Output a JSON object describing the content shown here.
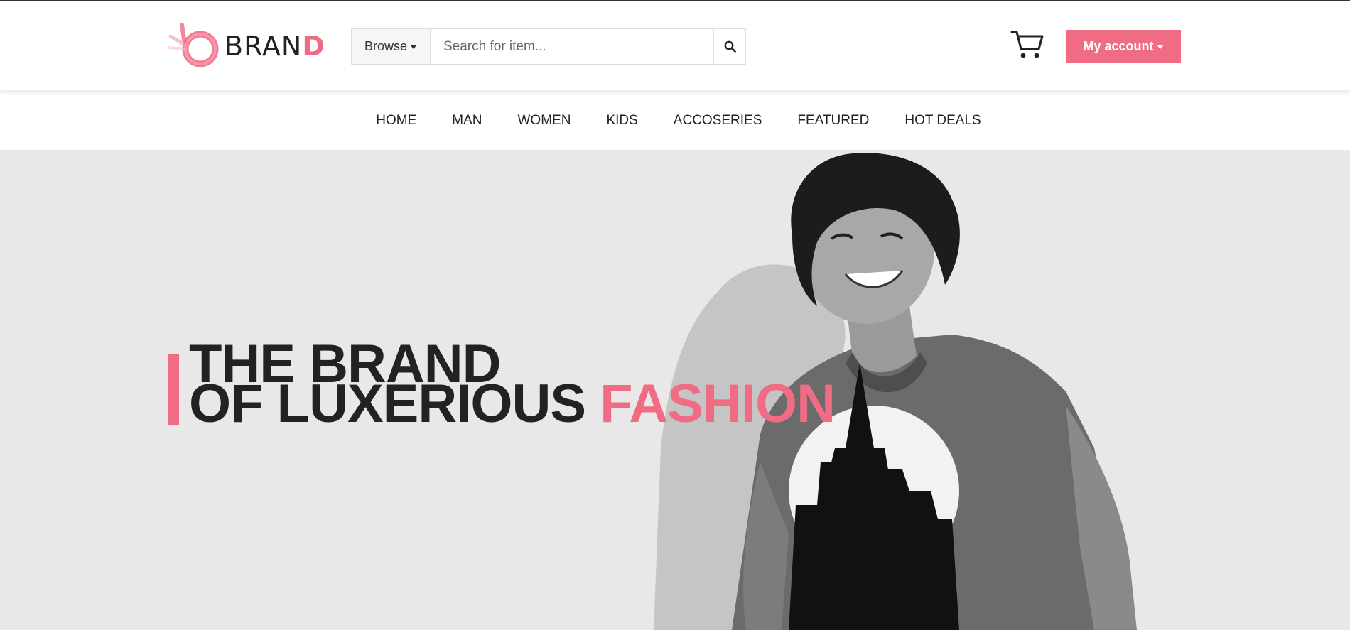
{
  "header": {
    "brand": {
      "text_main": "BRAN",
      "text_accent": "D",
      "logo_icon": "brand-b-logo-icon"
    },
    "browse": {
      "label": "Browse",
      "icon": "caret-down-icon"
    },
    "search": {
      "placeholder": "Search for item...",
      "value": "",
      "button_icon": "search-icon"
    },
    "cart": {
      "icon": "cart-icon"
    },
    "account": {
      "label": "My account",
      "icon": "caret-down-icon"
    }
  },
  "nav": {
    "items": [
      {
        "label": "HOME"
      },
      {
        "label": "MAN"
      },
      {
        "label": "WOMEN"
      },
      {
        "label": "KIDS"
      },
      {
        "label": "ACCOSERIES"
      },
      {
        "label": "FEATURED"
      },
      {
        "label": "HOT DEALS"
      }
    ]
  },
  "hero": {
    "line1": "THE BRAND",
    "line2_main": "OF LUXERIOUS ",
    "line2_accent": "FASHION",
    "image": "smiling-man-curly-hair-graphic-tee-photo"
  },
  "colors": {
    "accent": "#f06b84",
    "hero_bg": "#e8e8e8",
    "text": "#222222"
  }
}
